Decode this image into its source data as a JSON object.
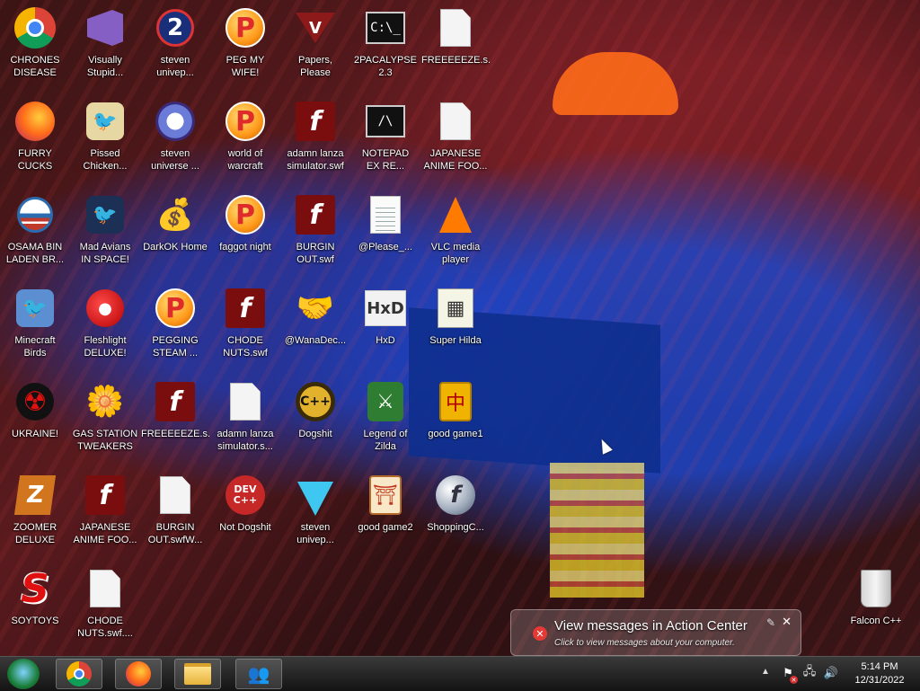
{
  "desktop": {
    "icons": [
      {
        "id": "chrones-disease",
        "label": "CHRONES\nDISEASE",
        "icon": "chrome-icon",
        "glyph": ""
      },
      {
        "id": "visually-stupid",
        "label": "Visually\nStupid...",
        "icon": "visual-studio-icon",
        "glyph": ""
      },
      {
        "id": "steven-univer-1",
        "label": "steven\nunivер...",
        "icon": "steven-2-icon",
        "glyph": "2"
      },
      {
        "id": "peg-my-wife",
        "label": "PEG MY WIFE!",
        "icon": "peggle-icon",
        "glyph": "P"
      },
      {
        "id": "papers-please",
        "label": "Papers,\nPlease",
        "icon": "papers-please-icon",
        "glyph": "V"
      },
      {
        "id": "2pacalypse",
        "label": "2PACALYPSE\n2.3",
        "icon": "cmd-icon",
        "glyph": "C:\\_"
      },
      {
        "id": "freeeeeze-1",
        "label": "FREEEEEZE.s...",
        "icon": "blank-file-icon",
        "glyph": ""
      },
      {
        "id": "furry-cucks",
        "label": "FURRY CUCKS",
        "icon": "firefox-icon",
        "glyph": ""
      },
      {
        "id": "pissed-chicken",
        "label": "Pissed\nChicken...",
        "icon": "angry-birds-seasons-icon",
        "glyph": "🐦"
      },
      {
        "id": "steven-universe-2",
        "label": "steven\nuniverse ...",
        "icon": "gem-icon",
        "glyph": ""
      },
      {
        "id": "world-of-warcraft",
        "label": "world of\nwarcraft",
        "icon": "peggle-icon",
        "glyph": "P"
      },
      {
        "id": "adamn-lanza-swf",
        "label": "adamn lanza\nsimulator.swf",
        "icon": "flash-icon",
        "glyph": "f"
      },
      {
        "id": "notepad-xtreme",
        "label": "NOTEPAD\nEX RE...",
        "icon": "notepad-icon",
        "glyph": "/\\"
      },
      {
        "id": "japanese-anime-1",
        "label": "JAPANESE\nANIME FOO...",
        "icon": "blank-file-icon",
        "glyph": ""
      },
      {
        "id": "osama-bin-laden",
        "label": "OSAMA BIN\nLADEN BR...",
        "icon": "obama-logo-icon",
        "glyph": ""
      },
      {
        "id": "mad-avians",
        "label": "Mad Avians\nIN SPACE!",
        "icon": "angry-birds-space-icon",
        "glyph": "🐦"
      },
      {
        "id": "darkok-home",
        "label": "DarkOK Home",
        "icon": "money-bag-icon",
        "glyph": "💰"
      },
      {
        "id": "faggot-night",
        "label": "faggot night",
        "icon": "peggle-icon",
        "glyph": "P"
      },
      {
        "id": "burgin-out-swf",
        "label": "BURGIN\nOUT.swf",
        "icon": "flash-icon",
        "glyph": "f"
      },
      {
        "id": "please-txt",
        "label": "@Please_...",
        "icon": "text-file-icon",
        "glyph": ""
      },
      {
        "id": "vlc",
        "label": "VLC media\nplayer",
        "icon": "vlc-icon",
        "glyph": ""
      },
      {
        "id": "minecraft-birds",
        "label": "Minecraft\nBirds",
        "icon": "angry-birds-icon",
        "glyph": "🐦"
      },
      {
        "id": "fleshlight-deluxe",
        "label": "Fleshlight\nDELUXE!",
        "icon": "red-creature-icon",
        "glyph": "●"
      },
      {
        "id": "pegging-steam",
        "label": "PEGGING\nSTEAM ...",
        "icon": "peggle-icon",
        "glyph": "P"
      },
      {
        "id": "chode-nuts-swf",
        "label": "CHODE\nNUTS.swf",
        "icon": "flash-icon",
        "glyph": "f"
      },
      {
        "id": "wanadec",
        "label": "@WanaDec...",
        "icon": "handshake-icon",
        "glyph": "🤝"
      },
      {
        "id": "hxd",
        "label": "HxD",
        "icon": "hxd-icon",
        "glyph": "HxD"
      },
      {
        "id": "super-hilda",
        "label": "Super Hilda",
        "icon": "pixel-game-icon",
        "glyph": "▦"
      },
      {
        "id": "ukraine",
        "label": "UKRAINE!",
        "icon": "radiation-icon",
        "glyph": "☢"
      },
      {
        "id": "gas-station-tweakers",
        "label": "GAS STATION\nTWEAKERS",
        "icon": "flower-icon",
        "glyph": "🌼"
      },
      {
        "id": "freeeeeze-swf",
        "label": "FREEEEEZE.s...",
        "icon": "flash-icon",
        "glyph": "f"
      },
      {
        "id": "adamn-lanza-s",
        "label": "adamn lanza\nsimulator.s...",
        "icon": "blank-file-icon",
        "glyph": ""
      },
      {
        "id": "dogshit",
        "label": "Dogshit",
        "icon": "dogshit-icon",
        "glyph": "C++"
      },
      {
        "id": "legend-of-zilda",
        "label": "Legend of\nZilda",
        "icon": "zelda-icon",
        "glyph": "⚔"
      },
      {
        "id": "good-game1",
        "label": "good game1",
        "icon": "mahjong-tile-icon",
        "glyph": "中"
      },
      {
        "id": "zoomer-deluxe",
        "label": "ZOOMER\nDELUXE",
        "icon": "zoomer-icon",
        "glyph": "Z"
      },
      {
        "id": "japanese-anime-swf",
        "label": "JAPANESE\nANIME FOO...",
        "icon": "flash-icon",
        "glyph": "f"
      },
      {
        "id": "burgin-out-swfw",
        "label": "BURGIN\nOUT.swfW...",
        "icon": "blank-file-icon",
        "glyph": ""
      },
      {
        "id": "not-dogshit",
        "label": "Not Dogshit",
        "icon": "dev-cpp-icon",
        "glyph": "DEV\nC++"
      },
      {
        "id": "steven-univer-3",
        "label": "steven\nunivер...",
        "icon": "diamond-icon",
        "glyph": ""
      },
      {
        "id": "good-game2",
        "label": "good game2",
        "icon": "torii-tile-icon",
        "glyph": "⛩"
      },
      {
        "id": "shoppingc",
        "label": "ShoppingC...",
        "icon": "shockwave-icon",
        "glyph": "f"
      },
      {
        "id": "soytoys",
        "label": "SOYTOYS",
        "icon": "soytoys-icon",
        "glyph": "S"
      },
      {
        "id": "chode-nuts-swf-file",
        "label": "CHODE\nNUTS.swf....",
        "icon": "blank-file-icon",
        "glyph": ""
      },
      {
        "id": "falcon-cpp",
        "label": "Falcon C++",
        "icon": "recycle-bin-icon",
        "glyph": ""
      }
    ]
  },
  "notification": {
    "title": "View messages in Action Center",
    "subtitle": "Click to view messages about your computer."
  },
  "taskbar": {
    "clock_time": "5:14 PM",
    "clock_date": "12/31/2022"
  }
}
